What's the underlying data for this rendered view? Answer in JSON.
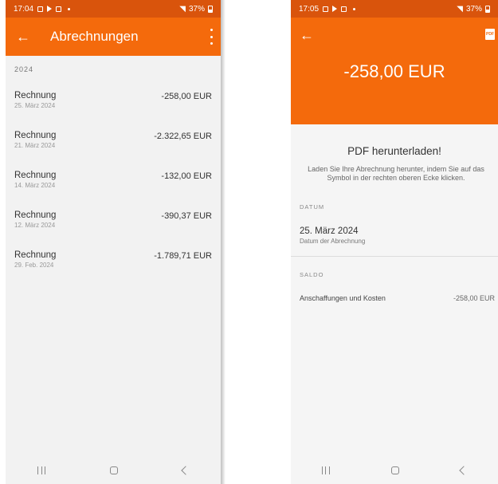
{
  "left": {
    "status": {
      "time": "17:04",
      "battery": "37%"
    },
    "appbar": {
      "title": "Abrechnungen"
    },
    "year": "2024",
    "items": [
      {
        "name": "Rechnung",
        "date": "25. März 2024",
        "amount": "-258,00 EUR"
      },
      {
        "name": "Rechnung",
        "date": "21. März 2024",
        "amount": "-2.322,65 EUR"
      },
      {
        "name": "Rechnung",
        "date": "14. März 2024",
        "amount": "-132,00 EUR"
      },
      {
        "name": "Rechnung",
        "date": "12. März 2024",
        "amount": "-390,37 EUR"
      },
      {
        "name": "Rechnung",
        "date": "29. Feb. 2024",
        "amount": "-1.789,71 EUR"
      }
    ]
  },
  "right": {
    "status": {
      "time": "17:05",
      "battery": "37%"
    },
    "amount": "-258,00 EUR",
    "pdf_icon_text": "PDF",
    "info_title": "PDF herunterladen!",
    "info_text": "Laden Sie Ihre Abrechnung herunter, indem Sie auf das Symbol in der rechten oberen Ecke klicken.",
    "datum_label": "DATUM",
    "datum_value": "25. März 2024",
    "datum_sub": "Datum der Abrechnung",
    "saldo_label": "SALDO",
    "saldo_item": "Anschaffungen und Kosten",
    "saldo_amount": "-258,00 EUR"
  },
  "colors": {
    "accent": "#f46a0c",
    "status_bar": "#d9540c"
  },
  "icons": [
    "back-arrow-icon",
    "more-vert-icon",
    "pdf-icon",
    "nav-recent-icon",
    "nav-home-icon",
    "nav-back-icon"
  ]
}
